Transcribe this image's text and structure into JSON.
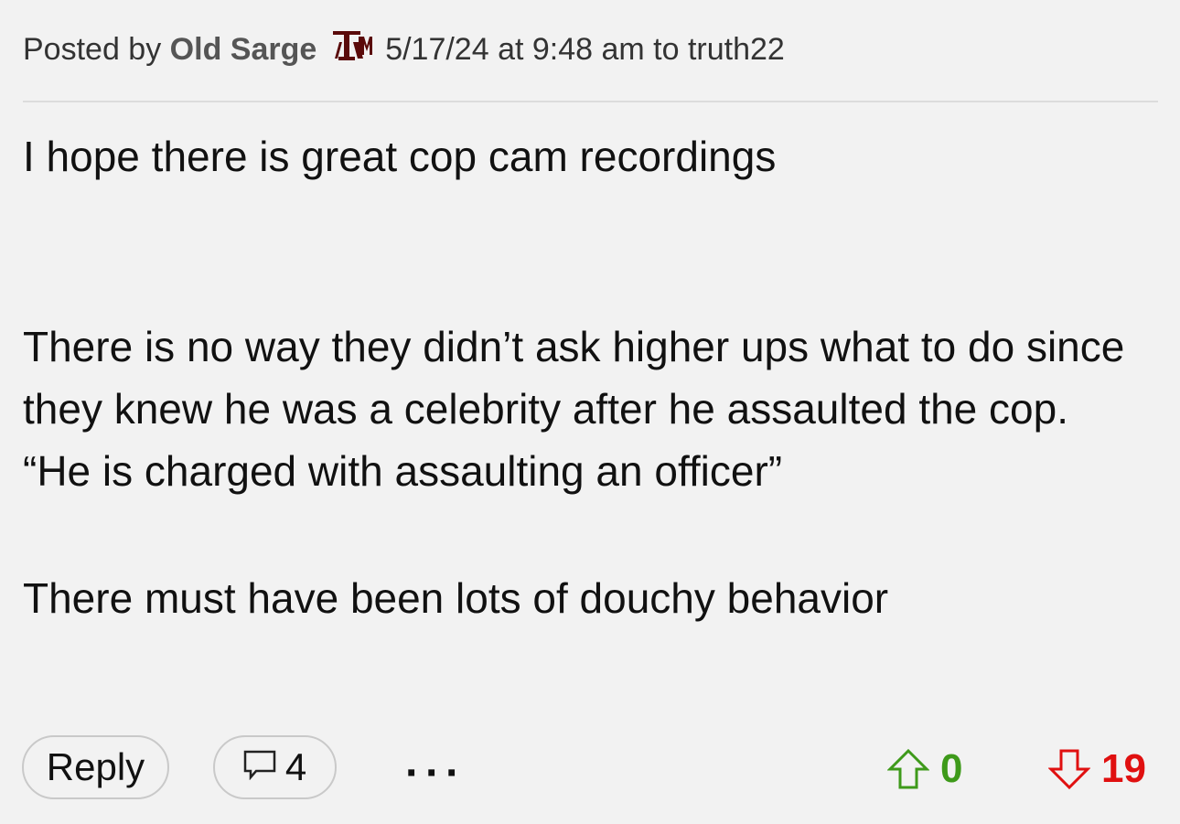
{
  "post": {
    "posted_by_prefix": "Posted by",
    "author": "Old Sarge",
    "author_badge": "texas-am-logo-icon",
    "meta": "5/17/24 at 9:48 am to truth22",
    "paragraphs": [
      "I hope there is great cop cam recordings",
      "There is no way they didn’t ask higher ups what to do since they knew he was a celebrity after he assaulted the cop. “He is charged with assaulting an officer”",
      "There must have been lots of douchy behavior"
    ]
  },
  "actions": {
    "reply_label": "Reply",
    "comment_count": "4",
    "more_label": "···",
    "upvotes": "0",
    "downvotes": "19"
  },
  "colors": {
    "background": "#f2f2f2",
    "upvote": "#3e9a1a",
    "downvote": "#e01010",
    "badge": "#5a0a0a"
  }
}
